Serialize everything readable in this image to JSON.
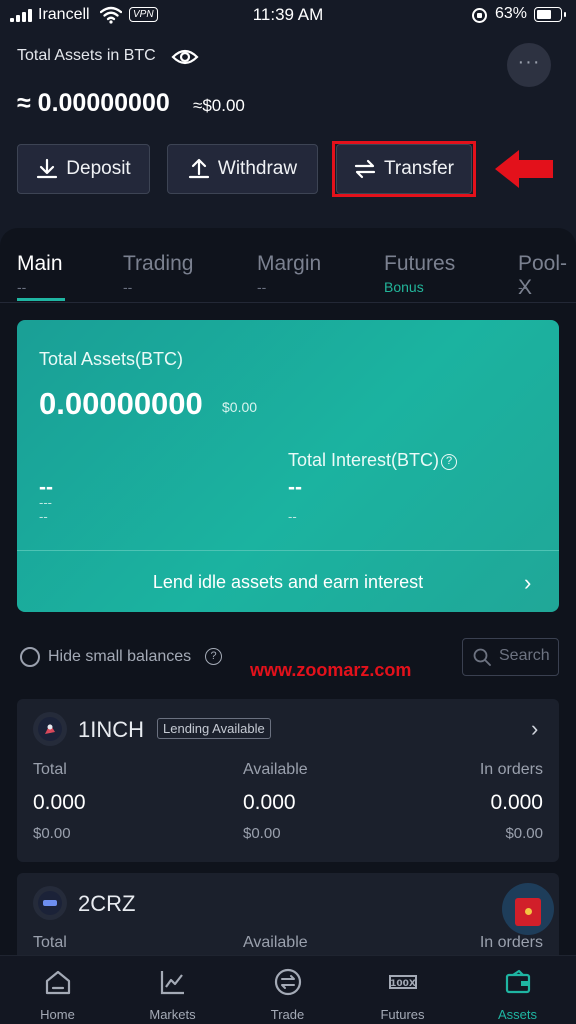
{
  "status_bar": {
    "carrier": "Irancell",
    "vpn": "VPN",
    "time": "11:39 AM",
    "battery": "63%"
  },
  "header": {
    "label": "Total Assets in BTC",
    "balance": "≈ 0.00000000",
    "usd": "≈$0.00",
    "more": "···",
    "buttons": {
      "deposit": "Deposit",
      "withdraw": "Withdraw",
      "transfer": "Transfer"
    }
  },
  "tabs": [
    {
      "label": "Main",
      "sub": "--"
    },
    {
      "label": "Trading",
      "sub": "--"
    },
    {
      "label": "Margin",
      "sub": "--"
    },
    {
      "label": "Futures",
      "sub": "Bonus"
    },
    {
      "label": "Pool-X",
      "sub": "--"
    }
  ],
  "card": {
    "label": "Total Assets(BTC)",
    "balance": "0.00000000",
    "usd": "$0.00",
    "interest_label": "Total Interest(BTC)",
    "q": "?",
    "left_big": "--",
    "left_mid": "---",
    "left_small": "--",
    "right_big": "--",
    "right_small": "--",
    "lend_text": "Lend idle assets and earn interest",
    "chevron": "›"
  },
  "filters": {
    "hide_small": "Hide small balances",
    "q": "?",
    "search_placeholder": "Search"
  },
  "watermark": "www.zoomarz.com",
  "assets": [
    {
      "name": "1INCH",
      "badge": "Lending Available",
      "total_label": "Total",
      "available_label": "Available",
      "orders_label": "In orders",
      "total": "0.000",
      "available": "0.000",
      "orders": "0.000",
      "total_usd": "$0.00",
      "available_usd": "$0.00",
      "orders_usd": "$0.00"
    },
    {
      "name": "2CRZ",
      "total_label": "Total",
      "available_label": "Available",
      "orders_label": "In orders"
    }
  ],
  "nav": [
    {
      "label": "Home",
      "icon": "home-icon"
    },
    {
      "label": "Markets",
      "icon": "chart-icon"
    },
    {
      "label": "Trade",
      "icon": "swap-circle-icon"
    },
    {
      "label": "Futures",
      "icon": "100x-icon"
    },
    {
      "label": "Assets",
      "icon": "wallet-icon"
    }
  ],
  "colors": {
    "accent": "#1fb5a2",
    "highlight": "#e3111b",
    "background": "#151a26"
  }
}
